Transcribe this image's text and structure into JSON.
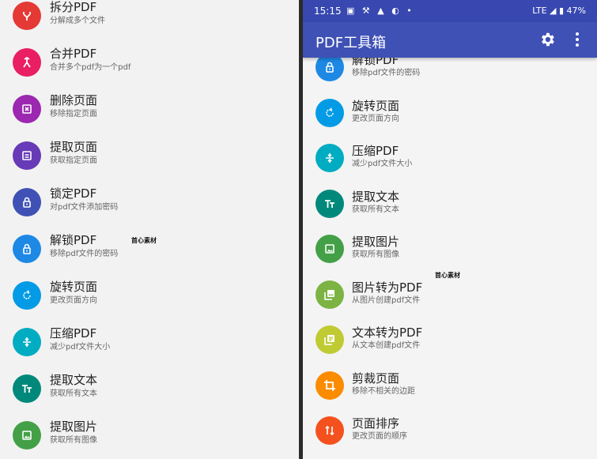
{
  "watermark": "首心素材",
  "left_items": [
    {
      "label": "拆分PDF",
      "sub": "分解成多个文件",
      "color": "#e53935",
      "icon": "split-icon"
    },
    {
      "label": "合并PDF",
      "sub": "合并多个pdf为一个pdf",
      "color": "#e91e63",
      "icon": "merge-icon"
    },
    {
      "label": "删除页面",
      "sub": "移除指定页面",
      "color": "#9c27b0",
      "icon": "delete-page-icon"
    },
    {
      "label": "提取页面",
      "sub": "获取指定页面",
      "color": "#673ab7",
      "icon": "extract-page-icon"
    },
    {
      "label": "锁定PDF",
      "sub": "对pdf文件添加密码",
      "color": "#3f51b5",
      "icon": "lock-icon"
    },
    {
      "label": "解锁PDF",
      "sub": "移除pdf文件的密码",
      "color": "#1e88e5",
      "icon": "unlock-icon"
    },
    {
      "label": "旋转页面",
      "sub": "更改页面方向",
      "color": "#039be5",
      "icon": "rotate-icon"
    },
    {
      "label": "压缩PDF",
      "sub": "减少pdf文件大小",
      "color": "#00acc1",
      "icon": "compress-icon"
    },
    {
      "label": "提取文本",
      "sub": "获取所有文本",
      "color": "#00897b",
      "icon": "text-icon"
    },
    {
      "label": "提取图片",
      "sub": "获取所有图像",
      "color": "#43a047",
      "icon": "image-icon"
    }
  ],
  "right": {
    "status": {
      "time": "15:15",
      "icons": "▣ ⚒ ▲ ◐ •",
      "right": "LTE ◢ ▮ 47%"
    },
    "title": "PDF工具箱",
    "items": [
      {
        "label": "解锁PDF",
        "sub": "移除pdf文件的密码",
        "color": "#1e88e5",
        "icon": "unlock-icon"
      },
      {
        "label": "旋转页面",
        "sub": "更改页面方向",
        "color": "#039be5",
        "icon": "rotate-icon"
      },
      {
        "label": "压缩PDF",
        "sub": "减少pdf文件大小",
        "color": "#00acc1",
        "icon": "compress-icon"
      },
      {
        "label": "提取文本",
        "sub": "获取所有文本",
        "color": "#00897b",
        "icon": "text-icon"
      },
      {
        "label": "提取图片",
        "sub": "获取所有图像",
        "color": "#43a047",
        "icon": "image-icon"
      },
      {
        "label": "图片转为PDF",
        "sub": "从图片创建pdf文件",
        "color": "#7cb342",
        "icon": "images-to-pdf-icon"
      },
      {
        "label": "文本转为PDF",
        "sub": "从文本创建pdf文件",
        "color": "#c0ca33",
        "icon": "text-to-pdf-icon"
      },
      {
        "label": "剪裁页面",
        "sub": "移除不相关的边距",
        "color": "#fb8c00",
        "icon": "crop-icon"
      },
      {
        "label": "页面排序",
        "sub": "更改页面的顺序",
        "color": "#f4511e",
        "icon": "reorder-icon"
      }
    ]
  }
}
